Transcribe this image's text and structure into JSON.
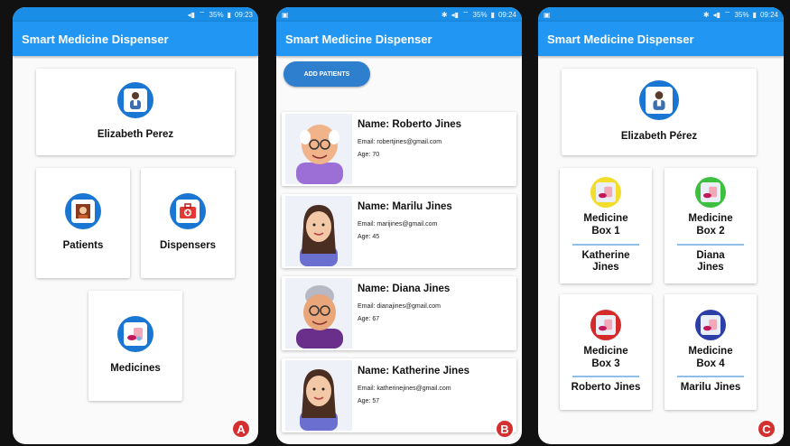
{
  "status": {
    "a": {
      "battery": "35%",
      "time": "09:23"
    },
    "b": {
      "battery": "35%",
      "time": "09:24"
    },
    "c": {
      "battery": "35%",
      "time": "09:24"
    }
  },
  "app_title": "Smart Medicine Dispenser",
  "screenA": {
    "user_name": "Elizabeth Perez",
    "tiles": {
      "patients": "Patients",
      "dispensers": "Dispensers",
      "medicines": "Medicines"
    },
    "badge": "A"
  },
  "screenB": {
    "add_button": "ADD PATIENTS",
    "patients": [
      {
        "name": "Name: Roberto Jines",
        "email": "Email: robertjines@gmail.com",
        "age": "Age: 70"
      },
      {
        "name": "Name: Marilu Jines",
        "email": "Email: marijines@gmail.com",
        "age": "Age: 45"
      },
      {
        "name": "Name: Diana Jines",
        "email": "Email: dianajines@gmail.com",
        "age": "Age: 67"
      },
      {
        "name": "Name: Katherine Jines",
        "email": "Email: katherinejines@gmail.com",
        "age": "Age: 57"
      }
    ],
    "badge": "B"
  },
  "screenC": {
    "user_name": "Elizabeth Pérez",
    "boxes": [
      {
        "title": "Medicine\nBox 1",
        "patient": "Katherine\nJines",
        "color": "#f2dd2c"
      },
      {
        "title": "Medicine\nBox 2",
        "patient": "Diana\nJines",
        "color": "#3fbf3f"
      },
      {
        "title": "Medicine\nBox 3",
        "patient": "Roberto Jines",
        "color": "#d42a2a"
      },
      {
        "title": "Medicine\nBox 4",
        "patient": "Marilu Jines",
        "color": "#2c3fa8"
      }
    ],
    "badge": "C"
  },
  "colors": {
    "appbar": "#2196f3",
    "statusbar": "#1a8ee6",
    "accent": "#1976d2",
    "badge": "#d3302f"
  }
}
